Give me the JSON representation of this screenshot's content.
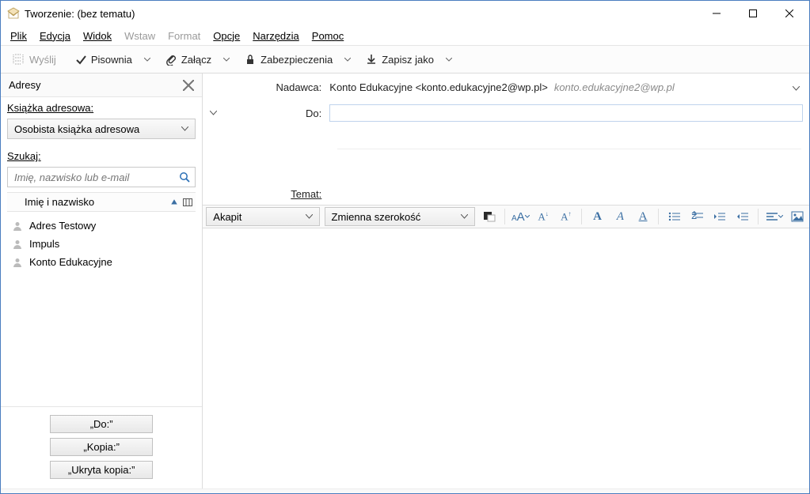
{
  "window": {
    "title": "Tworzenie: (bez tematu)"
  },
  "menu": {
    "file": "Plik",
    "edit": "Edycja",
    "view": "Widok",
    "insert": "Wstaw",
    "format": "Format",
    "options": "Opcje",
    "tools": "Narzędzia",
    "help": "Pomoc"
  },
  "toolbar": {
    "send": "Wyślij",
    "spelling": "Pisownia",
    "attach": "Załącz",
    "security": "Zabezpieczenia",
    "saveas": "Zapisz jako"
  },
  "sidebar": {
    "title": "Adresy",
    "addressbook_label": "Książka adresowa:",
    "addressbook_value": "Osobista książka adresowa",
    "search_label": "Szukaj:",
    "search_placeholder": "Imię, nazwisko lub e-mail",
    "list_header": "Imię i nazwisko",
    "contacts": [
      "Adres Testowy",
      "Impuls",
      "Konto Edukacyjne"
    ],
    "btn_to": "„Do:”",
    "btn_cc": "„Kopia:”",
    "btn_bcc": "„Ukryta kopia:”"
  },
  "compose": {
    "from_label": "Nadawca:",
    "from_value": "Konto Edukacyjne <konto.edukacyjne2@wp.pl>",
    "from_account": "konto.edukacyjne2@wp.pl",
    "to_label": "Do:",
    "subject_label": "Temat:"
  },
  "formatbar": {
    "paragraph": "Akapit",
    "font": "Zmienna szerokość"
  }
}
